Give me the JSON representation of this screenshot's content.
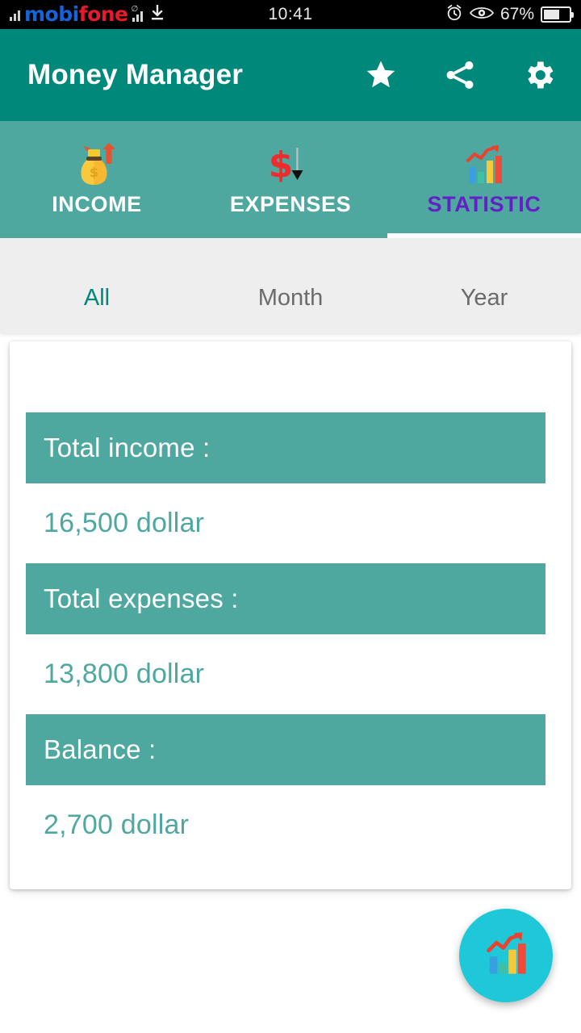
{
  "status_bar": {
    "carrier_part1": "mobi",
    "carrier_part2": "fone",
    "time": "10:41",
    "battery_percent": "67%",
    "icons": [
      "signal-bars-icon",
      "download-icon",
      "alarm-clock-icon",
      "eye-icon",
      "battery-icon"
    ]
  },
  "app_bar": {
    "title": "Money Manager",
    "actions": [
      {
        "name": "star-icon",
        "label": "Favorite"
      },
      {
        "name": "share-icon",
        "label": "Share"
      },
      {
        "name": "gear-icon",
        "label": "Settings"
      }
    ],
    "background_color": "#00897B"
  },
  "tabs": [
    {
      "label": "INCOME",
      "icon": "money-bag-up-arrow-icon",
      "active": false
    },
    {
      "label": "EXPENSES",
      "icon": "dollar-down-arrow-icon",
      "active": false
    },
    {
      "label": "STATISTIC",
      "icon": "bar-chart-icon",
      "active": true
    }
  ],
  "tab_bar": {
    "background_color": "#4FA89F",
    "active_label_color": "#6320C4",
    "indicator_color": "#FFFFFF"
  },
  "filters": [
    {
      "label": "All",
      "active": true
    },
    {
      "label": "Month",
      "active": false
    },
    {
      "label": "Year",
      "active": false
    }
  ],
  "filter_bar": {
    "active_color": "#00897B",
    "inactive_color": "#6B6B6B",
    "background_color": "#EEEEEE"
  },
  "summary_card": {
    "accent_color": "#4FA89F",
    "rows": [
      {
        "label": "Total income :",
        "value": "16,500 dollar"
      },
      {
        "label": "Total expenses :",
        "value": "13,800 dollar"
      },
      {
        "label": "Balance :",
        "value": "2,700 dollar"
      }
    ]
  },
  "fab": {
    "icon": "bar-chart-icon",
    "background_color": "#1EC8D8"
  },
  "chart_data": {
    "type": "table",
    "title": "Money Manager Statistic",
    "categories": [
      "Total income",
      "Total expenses",
      "Balance"
    ],
    "values": [
      16500,
      13800,
      2700
    ],
    "unit": "dollar",
    "period_filter": "All"
  }
}
